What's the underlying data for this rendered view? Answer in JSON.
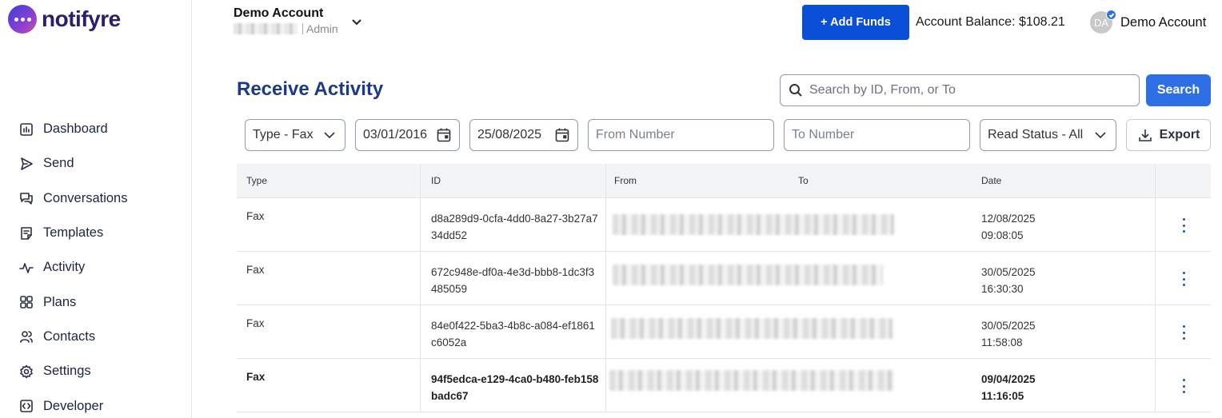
{
  "brand": {
    "name": "notifyre"
  },
  "account": {
    "name": "Demo Account",
    "role": "Admin"
  },
  "header": {
    "add_funds_label": "+ Add Funds",
    "balance_text": "Account Balance: $108.21",
    "avatar_initials": "DA",
    "user_name": "Demo Account"
  },
  "sidebar": {
    "items": [
      {
        "label": "Dashboard",
        "icon": "dashboard-icon"
      },
      {
        "label": "Send",
        "icon": "send-icon"
      },
      {
        "label": "Conversations",
        "icon": "conversations-icon"
      },
      {
        "label": "Templates",
        "icon": "templates-icon"
      },
      {
        "label": "Activity",
        "icon": "activity-icon"
      },
      {
        "label": "Plans",
        "icon": "plans-icon"
      },
      {
        "label": "Contacts",
        "icon": "contacts-icon"
      },
      {
        "label": "Settings",
        "icon": "settings-icon"
      },
      {
        "label": "Developer",
        "icon": "developer-icon"
      }
    ]
  },
  "page": {
    "title": "Receive Activity"
  },
  "search": {
    "placeholder": "Search by ID, From, or To",
    "button_label": "Search"
  },
  "filters": {
    "type": "Type - Fax",
    "date_from": "03/01/2016",
    "date_to": "25/08/2025",
    "from_number_placeholder": "From Number",
    "to_number_placeholder": "To Number",
    "read_status": "Read Status - All",
    "export_label": "Export"
  },
  "table": {
    "columns": [
      "Type",
      "ID",
      "From",
      "To",
      "Date"
    ],
    "rows": [
      {
        "type": "Fax",
        "id": "d8a289d9-0cfa-4dd0-8a27-3b27a734dd52",
        "date": "12/08/2025",
        "time": "09:08:05",
        "unread": false
      },
      {
        "type": "Fax",
        "id": "672c948e-df0a-4e3d-bbb8-1dc3f3485059",
        "date": "30/05/2025",
        "time": "16:30:30",
        "unread": false
      },
      {
        "type": "Fax",
        "id": "84e0f422-5ba3-4b8c-a084-ef1861c6052a",
        "date": "30/05/2025",
        "time": "11:58:08",
        "unread": false
      },
      {
        "type": "Fax",
        "id": "94f5edca-e129-4ca0-b480-feb158badc67",
        "date": "09/04/2025",
        "time": "11:16:05",
        "unread": true
      }
    ]
  }
}
